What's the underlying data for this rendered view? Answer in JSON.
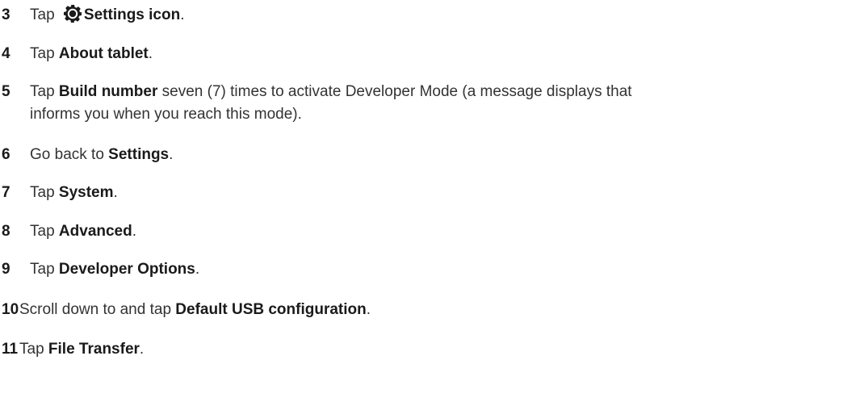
{
  "steps": [
    {
      "num": "3",
      "pre": "Tap ",
      "bold": "Settings icon",
      "post": ".",
      "icon": "gear-icon"
    },
    {
      "num": "4",
      "pre": "Tap ",
      "bold": "About tablet",
      "post": "."
    },
    {
      "num": "5",
      "pre": "Tap ",
      "bold": "Build number",
      "post": " seven (7) times to activate Developer Mode (a message displays that",
      "line2": "informs you when you reach this mode)."
    },
    {
      "num": "6",
      "pre": "Go back to ",
      "bold": "Settings",
      "post": "."
    },
    {
      "num": "7",
      "pre": "Tap ",
      "bold": "System",
      "post": "."
    },
    {
      "num": "8",
      "pre": "Tap ",
      "bold": "Advanced",
      "post": "."
    },
    {
      "num": "9",
      "pre": "Tap ",
      "bold": "Developer Options",
      "post": "."
    },
    {
      "num": "10",
      "pre": "Scroll down to and tap ",
      "bold": "Default USB configuration",
      "post": "."
    },
    {
      "num": "11",
      "pre": "Tap ",
      "bold": "File Transfer",
      "post": "."
    }
  ]
}
